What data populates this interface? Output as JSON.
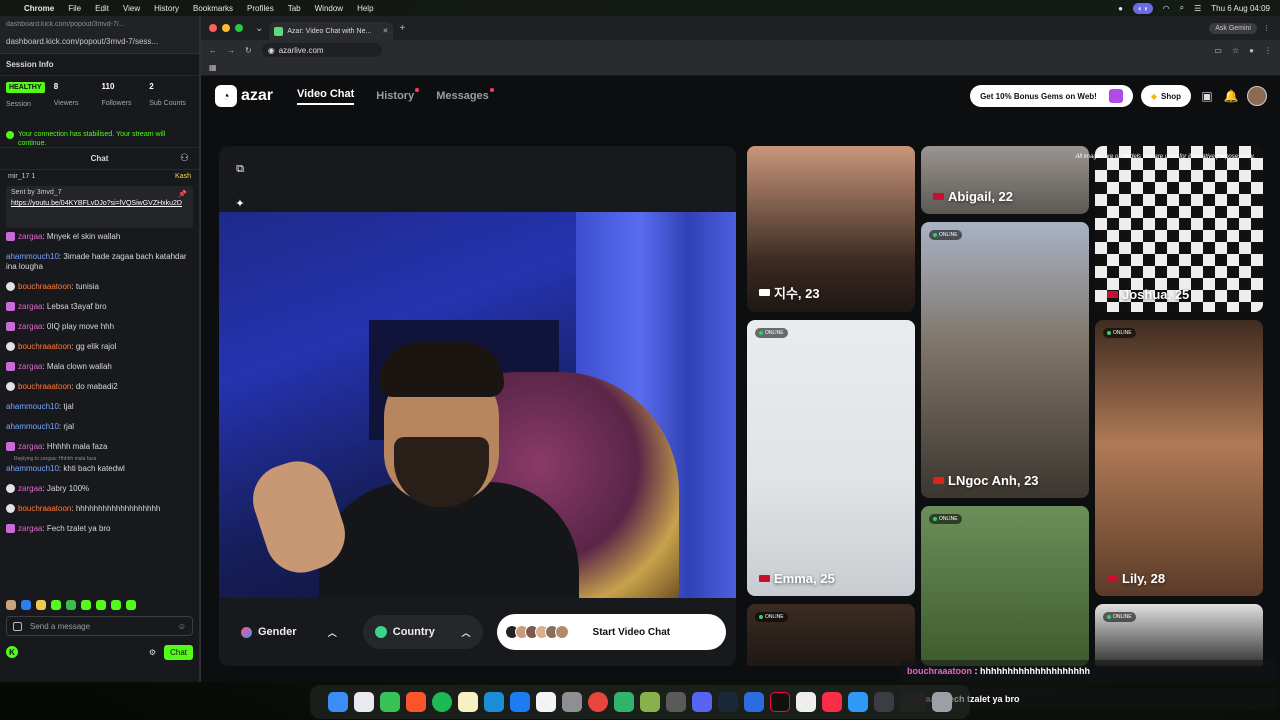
{
  "menubar": {
    "app": "Chrome",
    "items": [
      "File",
      "Edit",
      "View",
      "History",
      "Bookmarks",
      "Profiles",
      "Tab",
      "Window",
      "Help"
    ],
    "datetime": "Thu 6 Aug 04:09"
  },
  "kick": {
    "tab_title": "dashboard.kick.com/popout/3mvd-7/...",
    "url": "dashboard.kick.com/popout/3mvd-7/sess...",
    "session_title": "Session Info",
    "health_badge": "HEALTHY",
    "stats": [
      {
        "value": "",
        "label": "Session"
      },
      {
        "value": "8",
        "label": "Viewers"
      },
      {
        "value": "110",
        "label": "Followers"
      },
      {
        "value": "2",
        "label": "Sub Counts"
      }
    ],
    "notice": "Your connection has stabilised. Your stream will continue.",
    "chat_title": "Chat",
    "top_user": "mir_17",
    "top_count": "1",
    "top_right": "Kash",
    "pinned_sent": "Sent by",
    "pinned_user": "3mvd_7",
    "pinned_link": "https://youtu.be/04KYBFLvDJo?si=lVQSiwGVZHxku2D",
    "messages": [
      {
        "user": "zargaa",
        "text": "Mnyek el skin wallah",
        "color": "pink",
        "badge": "purple"
      },
      {
        "user": "ahammouch10",
        "text": "3imade hade zagaa bach katahdar ina lougha",
        "color": "blue",
        "badge": ""
      },
      {
        "user": "bouchraaatoon",
        "text": "tunisia",
        "color": "orange",
        "badge": "grey"
      },
      {
        "user": "zargaa",
        "text": "Lebsa t3ayaf bro",
        "color": "pink",
        "badge": "purple"
      },
      {
        "user": "zargaa",
        "text": "0IQ play move hhh",
        "color": "pink",
        "badge": "purple"
      },
      {
        "user": "bouchraaatoon",
        "text": "gg elik rajol",
        "color": "orange",
        "badge": "grey"
      },
      {
        "user": "zargaa",
        "text": "Mala clown wallah",
        "color": "pink",
        "badge": "purple"
      },
      {
        "user": "bouchraaatoon",
        "text": "do mabadi2",
        "color": "orange",
        "badge": "grey"
      },
      {
        "user": "ahammouch10",
        "text": "tjal",
        "color": "blue",
        "badge": ""
      },
      {
        "user": "ahammouch10",
        "text": "rjal",
        "color": "blue",
        "badge": ""
      },
      {
        "user": "zargaa",
        "text": "Hhhhh mala faza",
        "color": "pink",
        "badge": "purple"
      },
      {
        "user": "ahammouch10",
        "text": "khti bach katedwl",
        "color": "blue",
        "badge": ""
      },
      {
        "user": "zargaa",
        "text": "Jabry 100%",
        "color": "pink",
        "badge": "grey"
      },
      {
        "user": "bouchraaatoon",
        "text": "hhhhhhhhhhhhhhhhhhh",
        "color": "orange",
        "badge": "grey"
      },
      {
        "user": "zargaa",
        "text": "Fech tzalet ya bro",
        "color": "pink",
        "badge": "purple"
      }
    ],
    "reply_note": "Replying to zargaa: Hhhhh mala faza",
    "send_placeholder": "Send a message",
    "chat_button": "Chat"
  },
  "browser": {
    "tab_title": "Azar: Video Chat with Ne...",
    "url": "azarlive.com",
    "ask_gemini": "Ask Gemini"
  },
  "azar": {
    "logo": "azar",
    "nav": [
      {
        "label": "Video Chat",
        "active": true,
        "dot": false
      },
      {
        "label": "History",
        "active": false,
        "dot": true
      },
      {
        "label": "Messages",
        "active": false,
        "dot": true
      }
    ],
    "bonus": "Get 10% Bonus Gems on Web!",
    "shop": "Shop",
    "filters": {
      "gender": "Gender",
      "country": "Country"
    },
    "start_button": "Start Video Chat",
    "disclaimer": "All images are of models and are used for illustrative purposes only.",
    "cards": [
      {
        "name": "지수, 23",
        "online": false,
        "flag_color": "#ffffff"
      },
      {
        "name": "Abigail, 22",
        "online": false,
        "flag_color": "#c8102e"
      },
      {
        "name": "Joshua, 25",
        "online": false,
        "flag_color": "#c8102e"
      },
      {
        "name": "LNgoc Anh, 23",
        "online": true,
        "flag_color": "#da251d"
      },
      {
        "name": "Emma, 25",
        "online": true,
        "flag_color": "#c8102e"
      },
      {
        "name": "Lily, 28",
        "online": true,
        "flag_color": "#c8102e"
      },
      {
        "name": "",
        "online": true,
        "flag_color": ""
      },
      {
        "name": "",
        "online": true,
        "flag_color": ""
      },
      {
        "name": "",
        "online": true,
        "flag_color": ""
      }
    ],
    "online_label": "ONLINE"
  },
  "overlay_chat": [
    {
      "user": "bouchraaatoon",
      "text": "hhhhhhhhhhhhhhhhhhhh"
    },
    {
      "user": "zargaa",
      "text": "Fech tzalet ya bro"
    }
  ],
  "colors": {
    "kick_green": "#53fc18",
    "azar_bg": "#0d0e10",
    "online_green": "#2fd35f"
  }
}
